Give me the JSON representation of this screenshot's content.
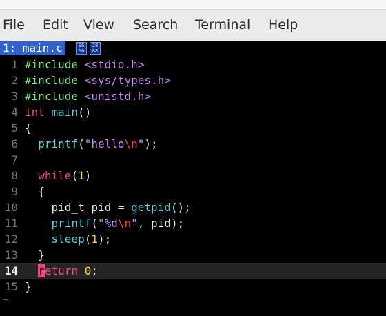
{
  "menu": [
    "File",
    "Edit",
    "View",
    "Search",
    "Terminal",
    "Help"
  ],
  "tab": {
    "label": "1: main.c",
    "glyph1": "E6 16",
    "glyph2": "28 88"
  },
  "lines": [
    {
      "n": "1",
      "parts": [
        [
          "pp",
          "#include "
        ],
        [
          "inc",
          "<stdio.h>"
        ]
      ]
    },
    {
      "n": "2",
      "parts": [
        [
          "pp",
          "#include "
        ],
        [
          "inc",
          "<sys/types.h>"
        ]
      ]
    },
    {
      "n": "3",
      "parts": [
        [
          "pp",
          "#include "
        ],
        [
          "inc",
          "<unistd.h>"
        ]
      ]
    },
    {
      "n": "4",
      "parts": [
        [
          "kw",
          "int "
        ],
        [
          "fn",
          "main"
        ],
        [
          "",
          "()"
        ]
      ]
    },
    {
      "n": "5",
      "parts": [
        [
          "",
          "{"
        ]
      ]
    },
    {
      "n": "6",
      "parts": [
        [
          "",
          "  "
        ],
        [
          "fn",
          "printf"
        ],
        [
          "",
          "("
        ],
        [
          "str",
          "\"hello"
        ],
        [
          "esc",
          "\\n"
        ],
        [
          "str",
          "\""
        ],
        [
          "",
          ");"
        ]
      ]
    },
    {
      "n": "7",
      "parts": []
    },
    {
      "n": "8",
      "parts": [
        [
          "",
          "  "
        ],
        [
          "kw",
          "while"
        ],
        [
          "",
          "("
        ],
        [
          "num",
          "1"
        ],
        [
          "",
          ")"
        ]
      ]
    },
    {
      "n": "9",
      "parts": [
        [
          "",
          "  {"
        ]
      ]
    },
    {
      "n": "10",
      "parts": [
        [
          "",
          "    pid_t pid = "
        ],
        [
          "fn",
          "getpid"
        ],
        [
          "",
          "();"
        ]
      ]
    },
    {
      "n": "11",
      "parts": [
        [
          "",
          "    "
        ],
        [
          "fn",
          "printf"
        ],
        [
          "",
          "("
        ],
        [
          "str",
          "\"%d"
        ],
        [
          "esc",
          "\\n"
        ],
        [
          "str",
          "\""
        ],
        [
          "",
          ", pid);"
        ]
      ]
    },
    {
      "n": "12",
      "parts": [
        [
          "",
          "    "
        ],
        [
          "fn",
          "sleep"
        ],
        [
          "",
          "("
        ],
        [
          "num",
          "1"
        ],
        [
          "",
          ");"
        ]
      ]
    },
    {
      "n": "13",
      "parts": [
        [
          "",
          "  }"
        ]
      ]
    },
    {
      "n": "14",
      "cur": true,
      "parts": [
        [
          "",
          "  "
        ],
        [
          "cursor",
          "r"
        ],
        [
          "kw",
          "eturn "
        ],
        [
          "num",
          "0"
        ],
        [
          "",
          ";"
        ]
      ]
    },
    {
      "n": "15",
      "parts": [
        [
          "",
          "}"
        ]
      ]
    }
  ],
  "tilde": "~"
}
